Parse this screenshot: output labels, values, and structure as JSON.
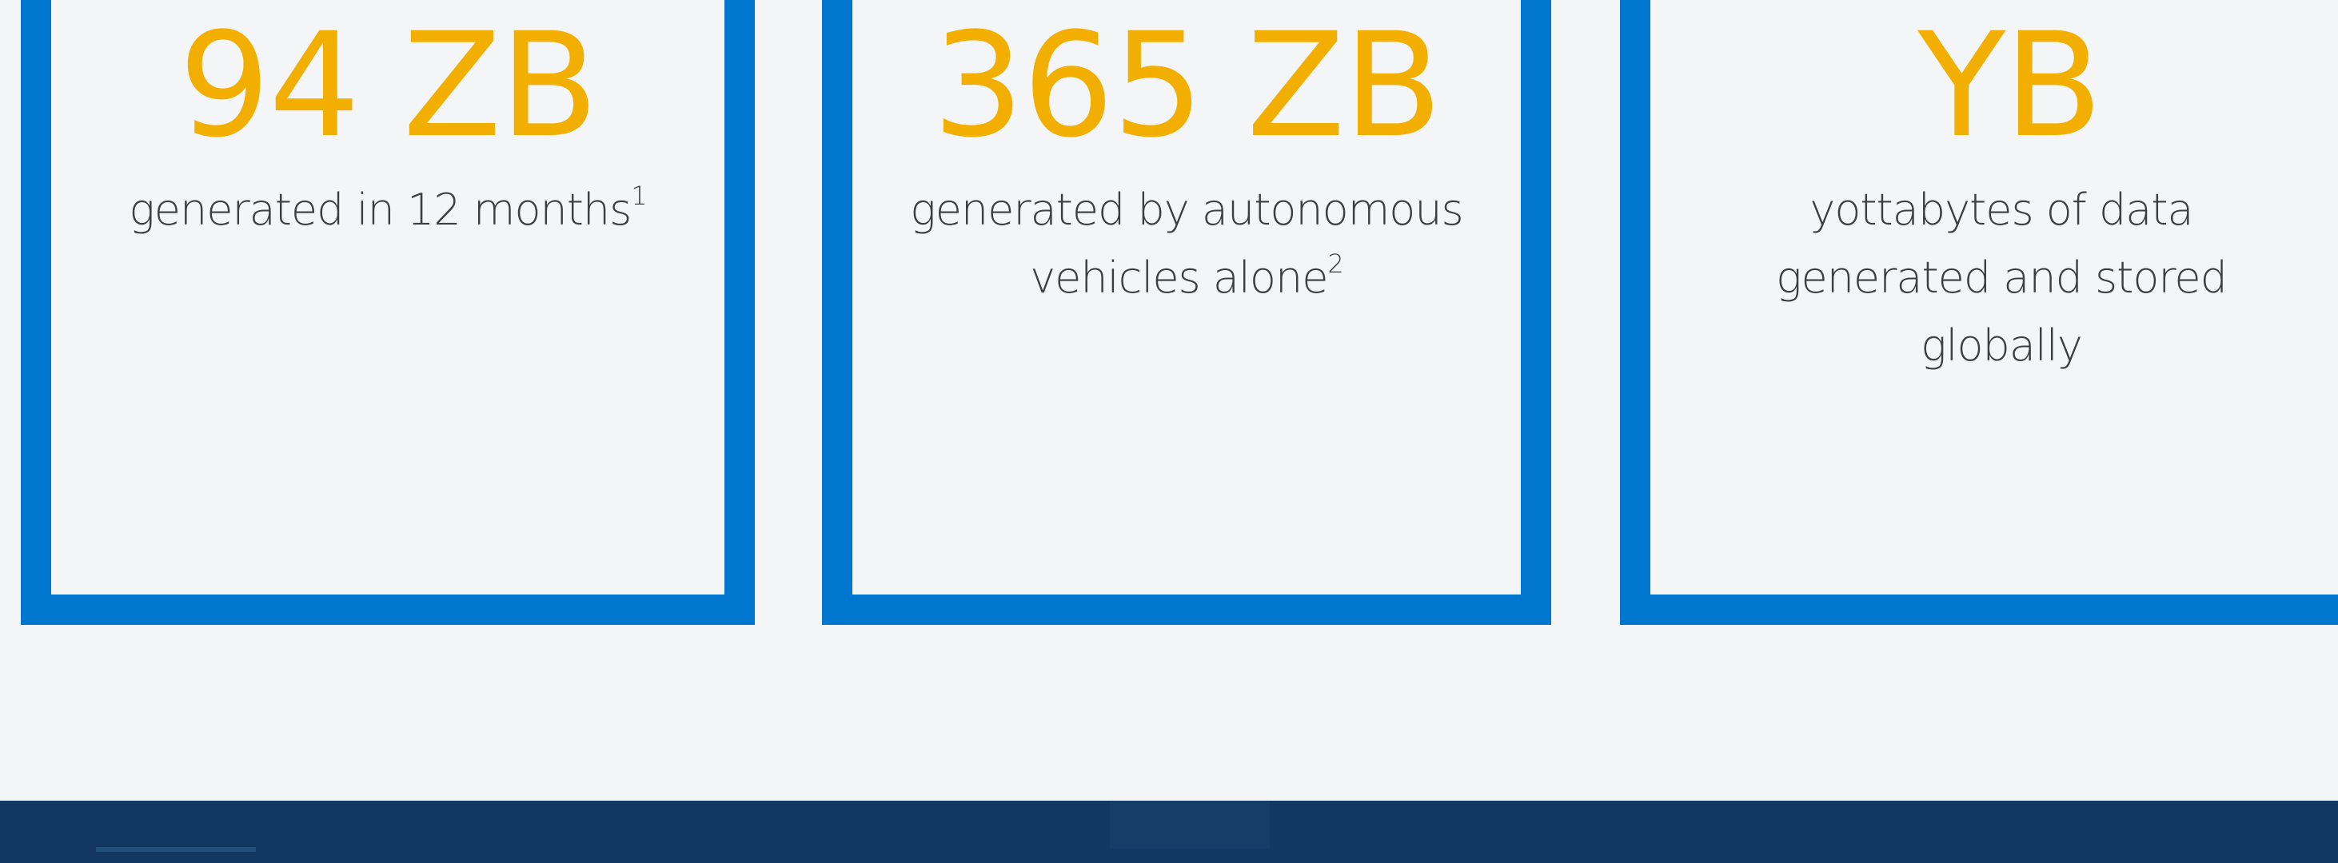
{
  "stats": [
    {
      "value": "94 ZB",
      "description": "generated in 12 months",
      "footnote": "1"
    },
    {
      "value": "365 ZB",
      "description_line1": "generated by autonomous",
      "description_line2": "vehicles alone",
      "footnote": "2"
    },
    {
      "value": "YB",
      "description_line1": "yottabytes of data",
      "description_line2": "generated and stored",
      "description_line3": "globally"
    }
  ],
  "colors": {
    "background": "#f4f5f7",
    "card_border": "#0076ce",
    "stat_value": "#f2af00",
    "text": "#3e3e3e",
    "footer": "#123861"
  }
}
